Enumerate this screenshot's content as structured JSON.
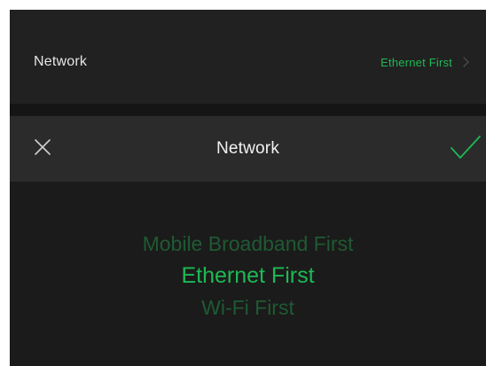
{
  "settings": {
    "network_label": "Network",
    "network_value": "Ethernet First"
  },
  "picker": {
    "title": "Network",
    "close_icon": "close-icon",
    "confirm_icon": "checkmark-icon",
    "options": [
      {
        "label": "Mobile Broadband First",
        "selected": false
      },
      {
        "label": "Ethernet First",
        "selected": true
      },
      {
        "label": "Wi-Fi First",
        "selected": false
      }
    ]
  },
  "colors": {
    "accent": "#1db954",
    "accent_dim": "#1f5a33",
    "background_card": "#212121",
    "background_header": "#2b2b2b",
    "background_body": "#1b1b1b"
  }
}
